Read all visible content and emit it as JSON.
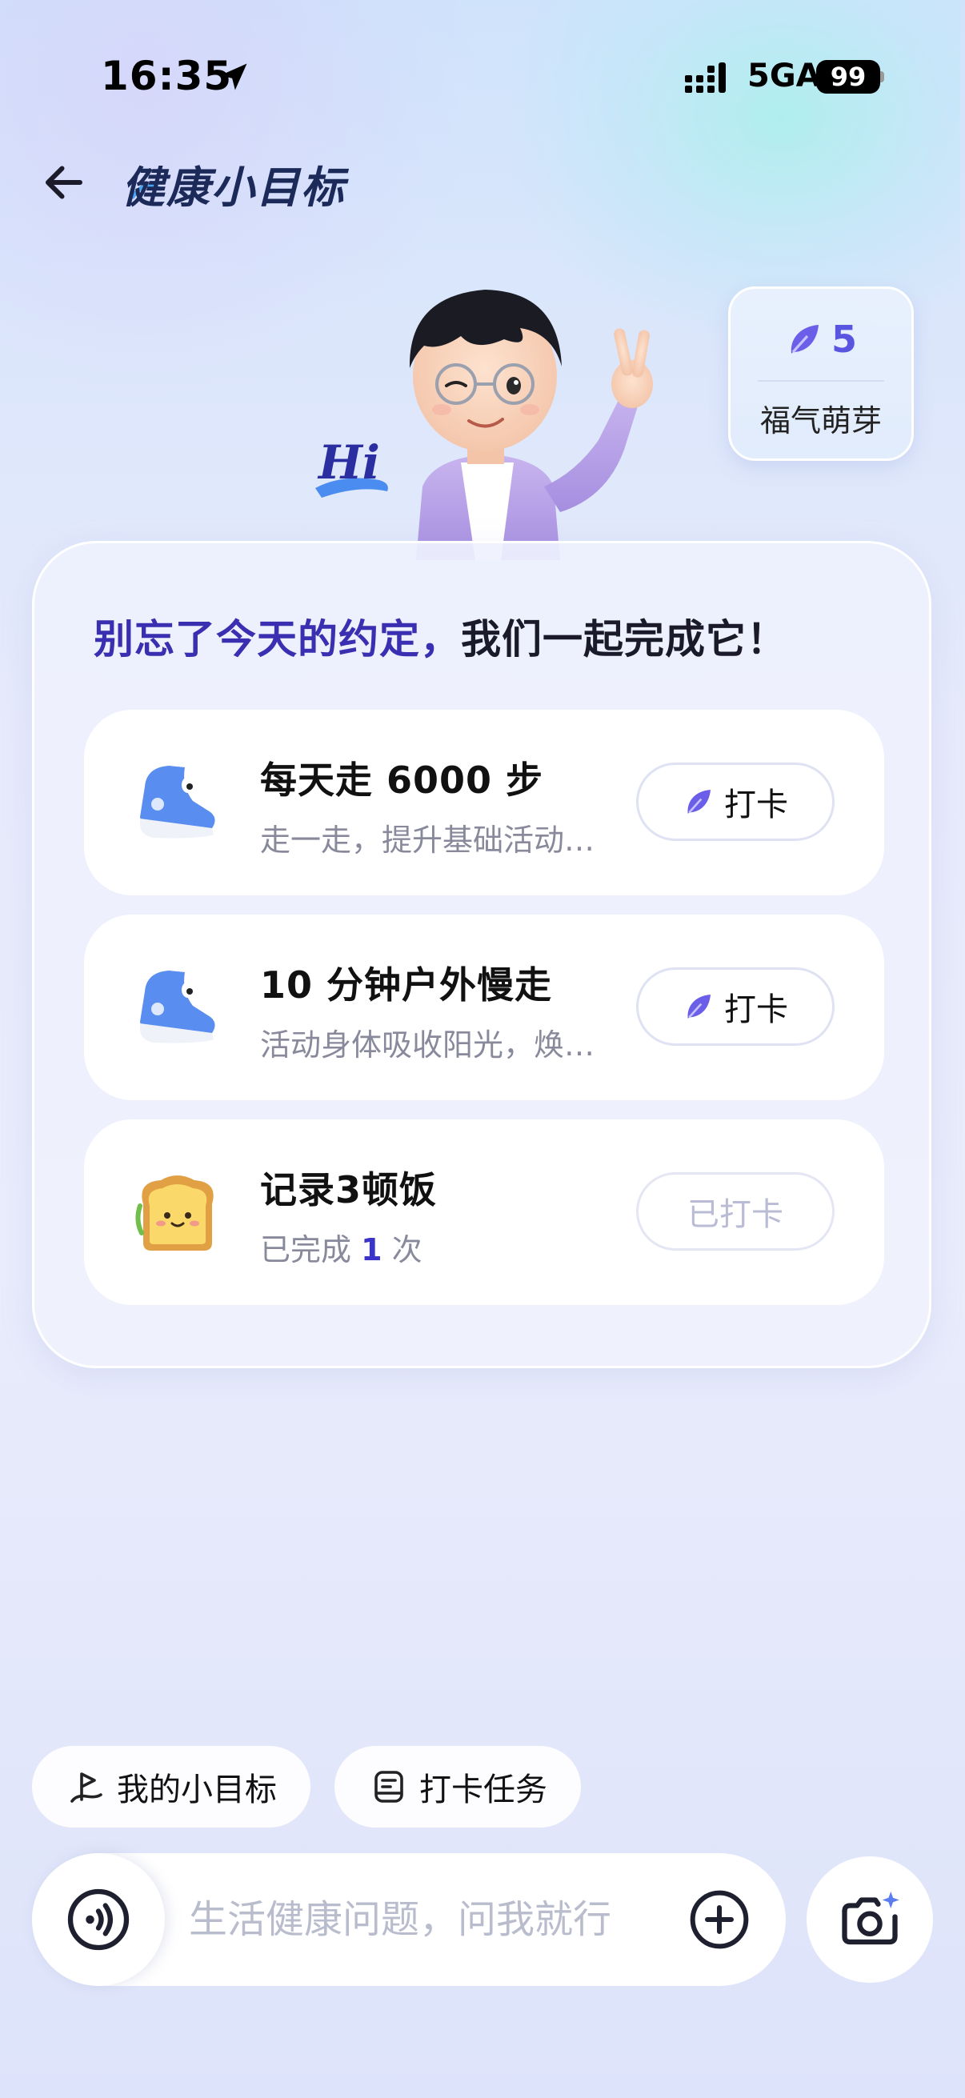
{
  "status_bar": {
    "time": "16:35",
    "network": "5GA",
    "battery": "99"
  },
  "header": {
    "title": "健康小目标"
  },
  "points": {
    "value": "5",
    "label": "福气萌芽",
    "icon": "leaf-icon"
  },
  "avatar": {
    "greeting": "Hi"
  },
  "main": {
    "headline_part1": "别忘了今天的约定，",
    "headline_part2": "我们一起完成它！",
    "tasks": [
      {
        "icon": "sneaker-icon",
        "title": "每天走 6000 步",
        "desc": "走一走，提升基础活动…",
        "button": "打卡",
        "done": false
      },
      {
        "icon": "sneaker-icon",
        "title": "10 分钟户外慢走",
        "desc": "活动身体吸收阳光，焕…",
        "button": "打卡",
        "done": false
      },
      {
        "icon": "toast-icon",
        "title": "记录3顿饭",
        "desc_prefix": "已完成",
        "desc_count": "1",
        "desc_suffix": "次",
        "button": "已打卡",
        "done": true
      }
    ]
  },
  "shortcuts": [
    {
      "label": "我的小目标",
      "icon": "flag-icon"
    },
    {
      "label": "打卡任务",
      "icon": "clipboard-icon"
    }
  ],
  "input_bar": {
    "placeholder": "生活健康问题，问我就行"
  },
  "colors": {
    "accent": "#5a55e0",
    "title": "#1c2a5a",
    "muted": "#888a9c"
  }
}
